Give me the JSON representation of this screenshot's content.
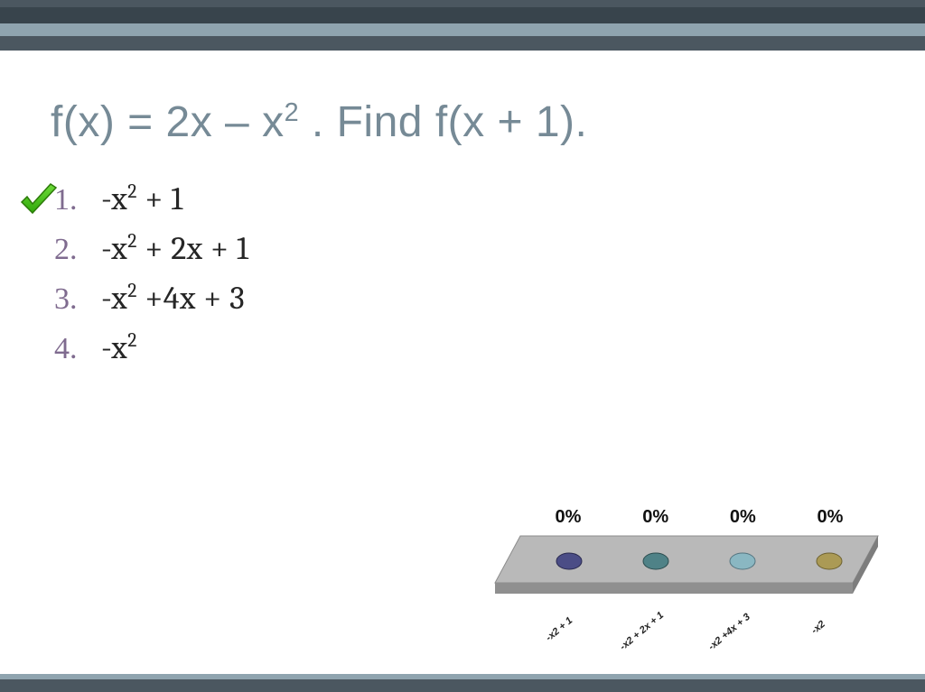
{
  "title_parts": {
    "a": "f(x) = 2x – x",
    "b": " .  Find f(x + 1)."
  },
  "options": [
    {
      "num": "1.",
      "prefix": "-x",
      "suffix": " + 1"
    },
    {
      "num": "2.",
      "prefix": "-x",
      "suffix": " + 2x + 1"
    },
    {
      "num": "3.",
      "prefix": "-x",
      "suffix": " +4x + 3"
    },
    {
      "num": "4.",
      "prefix": "-x",
      "suffix": ""
    }
  ],
  "correct_index": 0,
  "poll": {
    "percents": [
      "0%",
      "0%",
      "0%",
      "0%"
    ],
    "labels": [
      "-x2 + 1",
      "-x2 + 2x + 1",
      "-x2 +4x + 3",
      "-x2"
    ],
    "dot_colors": [
      "#4b4d86",
      "#4f8287",
      "#8ab7c2",
      "#ab9a55"
    ]
  },
  "colors": {
    "title": "#768a96",
    "opt_num": "#7f6b8f",
    "pad_face": "#b9b9b9",
    "pad_side": "#8f8f8f"
  }
}
